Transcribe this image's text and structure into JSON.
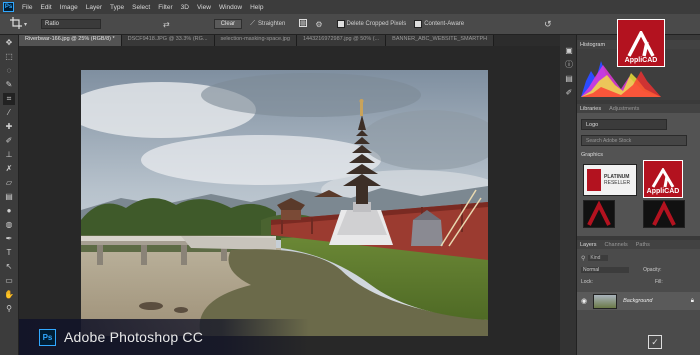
{
  "menubar": {
    "logo": "Ps",
    "items": [
      "File",
      "Edit",
      "Image",
      "Layer",
      "Type",
      "Select",
      "Filter",
      "3D",
      "View",
      "Window",
      "Help"
    ]
  },
  "options": {
    "ratio_value": "Ratio",
    "clear_label": "Clear",
    "straighten_label": "Straighten",
    "delete_cropped_label": "Delete Cropped Pixels",
    "content_aware_label": "Content-Aware"
  },
  "tabs": [
    "Riverbwar-166.jpg @ 25% (RGB/8) *",
    "DSCF9418.JPG @ 33.3% (RG...",
    "selection-masking-space.jpg",
    "1443216972987.jpg @ 50% (...",
    "BANNER_ABC_WEBSITE_SMARTPH"
  ],
  "panels": {
    "histogram_label": "Histogram",
    "libraries_label": "Libraries",
    "adjustments_label": "Adjustments",
    "library_select": "Logo",
    "search_placeholder": "Search Adobe Stock",
    "graphics_label": "Graphics",
    "layers_label": "Layers",
    "channels_label": "Channels",
    "paths_label": "Paths",
    "kind_label": "Kind",
    "blend_mode": "Normal",
    "opacity_label": "Opacity:",
    "fill_label": "Fill:",
    "lock_label": "Lock:",
    "layer_name": "Background"
  },
  "applicad": {
    "name": "AppliCAD",
    "platinum": "PLATINUM",
    "reseller": "RESELLER"
  },
  "footer": {
    "badge": "Ps",
    "product_name": "Adobe Photoshop CC"
  },
  "colors": {
    "accent": "#31a8ff",
    "applicad_red": "#b3121f"
  }
}
